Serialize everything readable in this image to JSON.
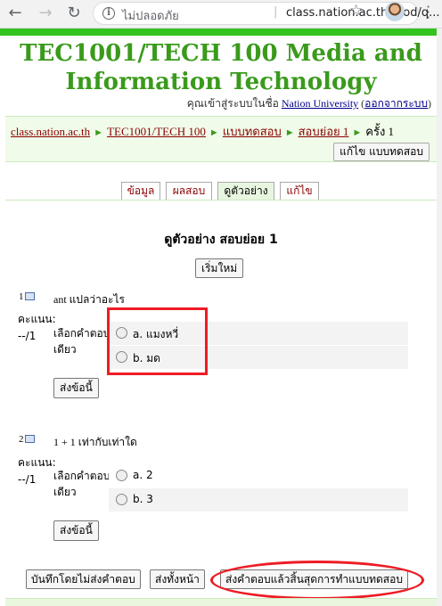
{
  "browser": {
    "back_icon": "back-arrow-icon",
    "forward_icon": "forward-arrow-icon",
    "reload_icon": "reload-icon",
    "security_label": "ไม่ปลอดภัย",
    "url": "class.nation.ac.th/mod/q..."
  },
  "course": {
    "title_line1": "TEC1001/TECH 100 Media and",
    "title_line2": "Information Technology"
  },
  "login": {
    "prefix": "คุณเข้าสู่ระบบในชื่อ",
    "user": "Nation University",
    "logout": "ออกจากระบบ"
  },
  "breadcrumb": {
    "items": [
      "class.nation.ac.th",
      "TEC1001/TECH 100",
      "แบบทดสอบ",
      "สอบย่อย 1"
    ],
    "current": "ครั้ง 1",
    "separator": "►"
  },
  "edit_quiz_label": "แก้ไข แบบทดสอบ",
  "tabs": [
    {
      "label": "ข้อมูล"
    },
    {
      "label": "ผลสอบ"
    },
    {
      "label": "ดูตัวอย่าง"
    },
    {
      "label": "แก้ไข"
    }
  ],
  "preview": {
    "title": "ดูตัวอย่าง สอบย่อย 1",
    "restart_label": "เริ่มใหม่"
  },
  "questions": [
    {
      "number": "1",
      "text": "ant แปลว่าอะไร",
      "grade_label": "คะแนน:",
      "grade_value": "--/1",
      "prompt_line1": "เลือกคำตอบ",
      "prompt_line2": "เดียว",
      "answers": [
        "a. แมงหวี่",
        "b. มด"
      ],
      "submit_label": "ส่งข้อนี้"
    },
    {
      "number": "2",
      "text": "1 + 1 เท่ากับเท่าใด",
      "grade_label": "คะแนน:",
      "grade_value": "--/1",
      "prompt_line1": "เลือกคำตอบ",
      "prompt_line2": "เดียว",
      "answers": [
        "a. 2",
        "b. 3"
      ],
      "submit_label": "ส่งข้อนี้"
    }
  ],
  "footer_buttons": {
    "save_without_submit": "บันทึกโดยไม่ส่งคำตอบ",
    "submit_page": "ส่งทั้งหน้า",
    "submit_all_finish": "ส่งคำตอบแล้วสิ้นสุดการทำแบบทดสอบ"
  },
  "colors": {
    "brand_green": "#3a9a1c",
    "top_bar_green": "#34c421",
    "link_red": "#8b0000",
    "annotation_red": "#ee1c25"
  }
}
